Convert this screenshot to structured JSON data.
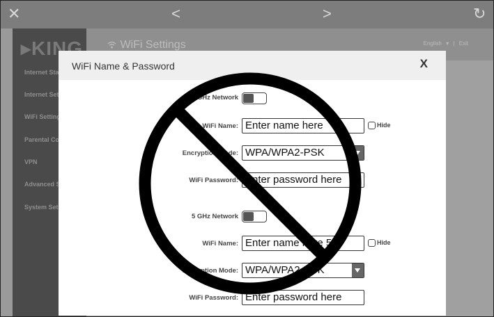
{
  "topbar": {
    "close_icon": "✕",
    "back_icon": "<",
    "forward_icon": ">",
    "refresh_icon": "↻"
  },
  "brand": {
    "logo_text": "▸KING"
  },
  "sidebar": {
    "items": [
      {
        "label": "Internet Sta"
      },
      {
        "label": "Internet Set"
      },
      {
        "label": "WiFi Setting"
      },
      {
        "label": "Parental Co"
      },
      {
        "label": "VPN"
      },
      {
        "label": "Advanced S"
      },
      {
        "label": "System Set"
      }
    ]
  },
  "header": {
    "title": "WiFi Settings",
    "wifi_icon": "wifi-icon",
    "language": "English",
    "dropdown_caret": "▾",
    "separator": "|",
    "exit": "Exit"
  },
  "modal": {
    "title": "WiFi Name & Password",
    "close_label": "X",
    "band_24": {
      "network_label": "2.4 GHz Network",
      "name_label": "WiFi Name:",
      "name_placeholder": "Enter name here",
      "hide_label": "Hide",
      "encryption_label": "Encryption Mode:",
      "encryption_value": "WPA/WPA2-PSK",
      "password_label": "WiFi Password:",
      "password_placeholder": "Enter password here"
    },
    "band_5": {
      "network_label": "5 GHz Network",
      "name_label": "WiFi Name:",
      "name_placeholder": "Enter name here 5G",
      "hide_label": "Hide",
      "encryption_label": "Encryption Mode:",
      "encryption_value": "WPA/WPA2-PSK",
      "password_label": "WiFi Password:",
      "password_placeholder": "Enter password here"
    }
  },
  "overlay": {
    "icon": "prohibition-sign-icon",
    "color": "#000000"
  },
  "colors": {
    "topbar": "#7d7d7d",
    "sidebar": "#4a4a4a",
    "backdrop": "#9a9a9a",
    "modal": "#ffffff",
    "toggle_knob": "#555555"
  }
}
